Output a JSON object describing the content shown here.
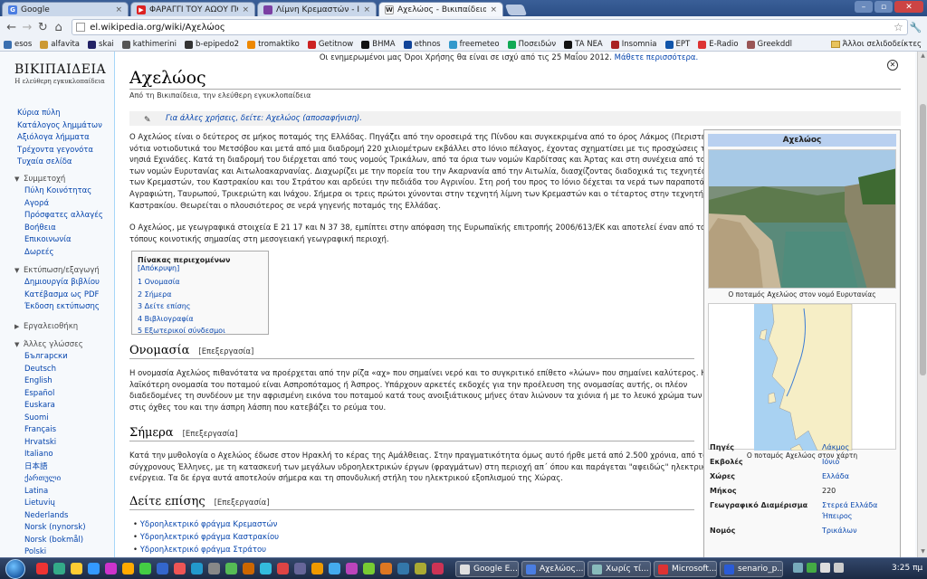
{
  "browser": {
    "tabs": [
      {
        "title": "Google",
        "close": "×",
        "favicon": "G",
        "color": "#4a7de2"
      },
      {
        "title": "ΦΑΡΑΓΓΙ ΤΟΥ ΑΩΟΥ ΠΟΤΑ",
        "close": "×",
        "favicon": "▶",
        "color": "#d22"
      },
      {
        "title": "Λίμνη Κρεμαστών - Ιστορ",
        "close": "×",
        "favicon": "",
        "color": "#7b3fa3"
      },
      {
        "title": "Αχελώος - Βικιπαίδεια",
        "close": "×",
        "favicon": "W",
        "color": "#444"
      }
    ],
    "url": "el.wikipedia.org/wiki/Αχελώος",
    "bookmarks": [
      {
        "label": "esos",
        "color": "#3a6fb0"
      },
      {
        "label": "alfavita",
        "color": "#c93"
      },
      {
        "label": "skai",
        "color": "#226"
      },
      {
        "label": "kathimerini",
        "color": "#555"
      },
      {
        "label": "b-epipedo2",
        "color": "#333"
      },
      {
        "label": "tromaktiko",
        "color": "#e80"
      },
      {
        "label": "Getitnow",
        "color": "#c22"
      },
      {
        "label": "BHMA",
        "color": "#111"
      },
      {
        "label": "ethnos",
        "color": "#149"
      },
      {
        "label": "freemeteo",
        "color": "#39c"
      },
      {
        "label": "Ποσειδών",
        "color": "#1a5"
      },
      {
        "label": "TA NEA",
        "color": "#111"
      },
      {
        "label": "Insomnia",
        "color": "#a22"
      },
      {
        "label": "EPT",
        "color": "#15a"
      },
      {
        "label": "E-Radio",
        "color": "#d33"
      },
      {
        "label": "Greekddl",
        "color": "#955"
      }
    ],
    "other_bookmarks": "Άλλοι σελιδοδείκτες"
  },
  "sidebar": {
    "logo_title": "ΒΙΚΙΠΑΙΔΕΙΑ",
    "logo_subtitle": "Η ελεύθερη εγκυκλοπαίδεια",
    "main_links": [
      "Κύρια πύλη",
      "Κατάλογος λημμάτων",
      "Αξιόλογα λήμματα",
      "Τρέχοντα γεγονότα",
      "Τυχαία σελίδα"
    ],
    "participation": {
      "title": "Συμμετοχή",
      "items": [
        "Πύλη Κοινότητας",
        "Αγορά",
        "Πρόσφατες αλλαγές",
        "Βοήθεια",
        "Επικοινωνία",
        "Δωρεές"
      ]
    },
    "print": {
      "title": "Εκτύπωση/εξαγωγή",
      "items": [
        "Δημιουργία βιβλίου",
        "Κατέβασμα ως PDF",
        "Έκδοση εκτύπωσης"
      ]
    },
    "tools": {
      "title": "Εργαλειοθήκη"
    },
    "languages": {
      "title": "Άλλες γλώσσες",
      "items": [
        "Български",
        "Deutsch",
        "English",
        "Español",
        "Euskara",
        "Suomi",
        "Français",
        "Hrvatski",
        "Italiano",
        "日本語",
        "ქართული",
        "Latina",
        "Lietuvių",
        "Nederlands",
        "Norsk (nynorsk)",
        "Norsk (bokmål)",
        "Polski"
      ]
    }
  },
  "article": {
    "notice": "Οι ενημερωμένοι μας Όροι Χρήσης θα είναι σε ισχύ από τις 25 Μαΐου 2012.",
    "notice_link": "Μάθετε περισσότερα.",
    "title": "Αχελώος",
    "from": "Από τη Βικιπαίδεια, την ελεύθερη εγκυκλοπαίδεια",
    "dablink": "Για άλλες χρήσεις, δείτε: Αχελώος (αποσαφήνιση).",
    "intro_lines": [
      "Ο Αχελώος είναι ο δεύτερος σε μήκος ποταμός της Ελλάδας. Πηγάζει από την οροσειρά της Πίνδου και συγκεκριμένα από το όρος Λάκμος (Περιστέρι),",
      "νότια νοτιοδυτικά του Μετσόβου και μετά από μια διαδρομή 220 χιλιομέτρων εκβάλλει στο Ιόνιο πέλαγος, έχοντας σχηματίσει με τις προσχώσεις του τα",
      "νησιά Εχινάδες. Κατά τη διαδρομή του διέρχεται από τους νομούς Τρικάλων, από τα όρια των νομών Καρδίτσας και Άρτας και στη συνέχεια από τα όρια",
      "των νομών Ευρυτανίας και Αιτωλοακαρνανίας. Διαχωρίζει με την πορεία του την Ακαρνανία από την Αιτωλία, διασχίζοντας διαδοχικά τις τεχνητές λίμνες",
      "των Κρεμαστών, του Καστρακίου και του Στράτου και αρδεύει την πεδιάδα του Αγρινίου. Στη ροή του προς το Ιόνιο δέχεται τα νερά των παραποτάμων του",
      "Αγραφιώτη, Ταυρωπού, Τρικεριώτη και Ινάχου. Σήμερα οι τρεις πρώτοι χύνονται στην τεχνητή λίμνη των Κρεμαστών και ο τέταρτος στην τεχνητή λίμνη του",
      "Καστρακίου. Θεωρείται ο πλουσιότερος σε νερά γηγενής ποταμός της Ελλάδας."
    ],
    "coords_lines": [
      "Ο Αχελώος, με γεωγραφικά στοιχεία Ε 21 17 και Ν 37 38, εμπίπτει στην απόφαση της Ευρωπαϊκής επιτροπής 2006/613/ΕΚ και αποτελεί έναν από τους",
      "τόπους κοινοτικής σημασίας στη μεσογειακή γεωγραφική περιοχή."
    ],
    "toc": {
      "title": "Πίνακας περιεχομένων",
      "hide": "[Απόκρυψη]",
      "items": [
        "1 Ονομασία",
        "2 Σήμερα",
        "3 Δείτε επίσης",
        "4 Βιβλιογραφία",
        "5 Εξωτερικοί σύνδεσμοι"
      ]
    },
    "edit_label": "[Επεξεργασία]",
    "sec1": {
      "title": "Ονομασία",
      "lines": [
        "Η ονομασία Αχελώος πιθανότατα να προέρχεται από την ρίζα «αχ» που σημαίνει νερό και το συγκριτικό επίθετο «λώων» που σημαίνει καλύτερος. Η",
        "λαϊκότερη ονομασία του ποταμού είναι Ασπροπόταμος ή Άσπρος. Υπάρχουν αρκετές εκδοχές για την προέλευση της ονομασίας αυτής, οι πλέον",
        "διαδεδομένες τη συνδέουν με την αφρισμένη εικόνα του ποταμού κατά τους ανοιξιάτικους μήνες όταν λιώνουν τα χιόνια ή με το λευκό χρώμα των χαλικιών",
        "στις όχθες του και την άσπρη λάσπη που κατεβάζει το ρεύμα του."
      ]
    },
    "sec2": {
      "title": "Σήμερα",
      "lines": [
        "Κατά την μυθολογία ο Αχελώος έδωσε στον Ηρακλή το κέρας της Αμάλθειας. Στην πραγματικότητα όμως αυτό ήρθε μετά από 2.500 χρόνια, από τους",
        "σύγχρονους Έλληνες, με τη κατασκευή των μεγάλων υδροηλεκτρικών έργων (φραγμάτων) στη περιοχή απ΄ όπου και παράγεται \"αφειδώς\" ηλεκτρική",
        "ενέργεια. Τα δε έργα αυτά αποτελούν σήμερα και τη σπονδυλική στήλη του ηλεκτρικού εξοπλισμού της Χώρας."
      ]
    },
    "sec3": {
      "title": "Δείτε επίσης",
      "items": [
        "Υδροηλεκτρικό φράγμα Κρεμαστών",
        "Υδροηλεκτρικό φράγμα Καστρακίου",
        "Υδροηλεκτρικό φράγμα Στράτου"
      ]
    }
  },
  "infobox": {
    "title": "Αχελώος",
    "photo_caption": "Ο ποταμός Αχελώος στον νομό Ευρυτανίας",
    "map_caption": "Ο ποταμός Αχελώος στον χάρτη",
    "rows": [
      {
        "key": "Πηγές",
        "value": "Λάκμος",
        "link": true
      },
      {
        "key": "Εκβολές",
        "value": "Ιόνιο",
        "link": true
      },
      {
        "key": "Χώρες",
        "value": "Ελλάδα",
        "link": true
      },
      {
        "key": "Μήκος",
        "value": "220",
        "link": false
      },
      {
        "key": "Γεωγραφικό Διαμέρισμα",
        "value": "Στερεά Ελλάδα",
        "link": true
      },
      {
        "key": "",
        "value": "Ήπειρος",
        "link": true
      },
      {
        "key": "Νομός",
        "value": "Τρικάλων",
        "link": true
      }
    ]
  },
  "taskbar": {
    "tasks": [
      {
        "label": "Google E...",
        "color": "#dfdfdf"
      },
      {
        "label": "Αχελώος...",
        "color": "#4a7de2"
      },
      {
        "label": "Χωρίς τί...",
        "color": "#8bb"
      },
      {
        "label": "Microsoft...",
        "color": "#d33"
      },
      {
        "label": "senario_p...",
        "color": "#2a5bd7"
      }
    ],
    "clock": "3:25 πμ"
  }
}
